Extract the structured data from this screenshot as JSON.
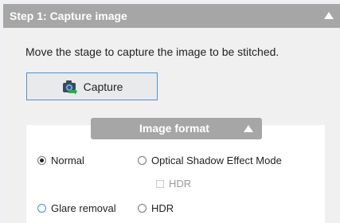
{
  "step_header": {
    "title": "Step 1: Capture image",
    "collapse_icon": "triangle-up-icon"
  },
  "description": "Move the stage to capture the image to be stitched.",
  "capture_button": {
    "label": "Capture",
    "icon": "camera-icon"
  },
  "image_format": {
    "title": "Image format",
    "collapse_icon": "triangle-up-icon",
    "options": {
      "normal": {
        "label": "Normal",
        "selected": true
      },
      "optical_shadow": {
        "label": "Optical Shadow Effect Mode",
        "selected": false
      },
      "hdr_sub": {
        "label": "HDR",
        "checked": false,
        "enabled": false
      },
      "glare_removal": {
        "label": "Glare removal",
        "selected": false
      },
      "hdr": {
        "label": "HDR",
        "selected": false
      }
    }
  },
  "colors": {
    "header_bg": "#a6a6a6",
    "button_border": "#4f92c8",
    "focus_radio": "#3f8ed0",
    "group_bg": "#ffffff"
  }
}
